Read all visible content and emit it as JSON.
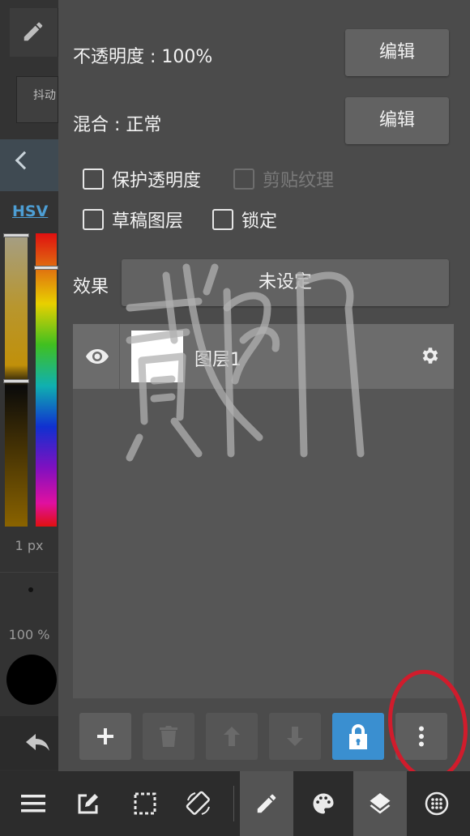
{
  "left_panel": {
    "tool_tag": "抖动",
    "color_tab": "HSV",
    "brush_size": "1 px",
    "brush_opacity": "100 %",
    "current_color": "#000000"
  },
  "layer_panel": {
    "opacity_label": "不透明度 : 100%",
    "opacity_edit_button": "编辑",
    "blend_label": "混合 : 正常",
    "blend_edit_button": "编辑",
    "checkboxes": {
      "protect_alpha": "保护透明度",
      "clipping": "剪贴纹理",
      "draft_layer": "草稿图层",
      "lock": "锁定"
    },
    "effect_label": "效果",
    "effect_value": "未设定",
    "layers": [
      {
        "name": "图层1",
        "visible": true
      }
    ],
    "accent_color": "#3a8fd0"
  },
  "watermark_text": "贰门",
  "annotation_color": "#d01c2c"
}
